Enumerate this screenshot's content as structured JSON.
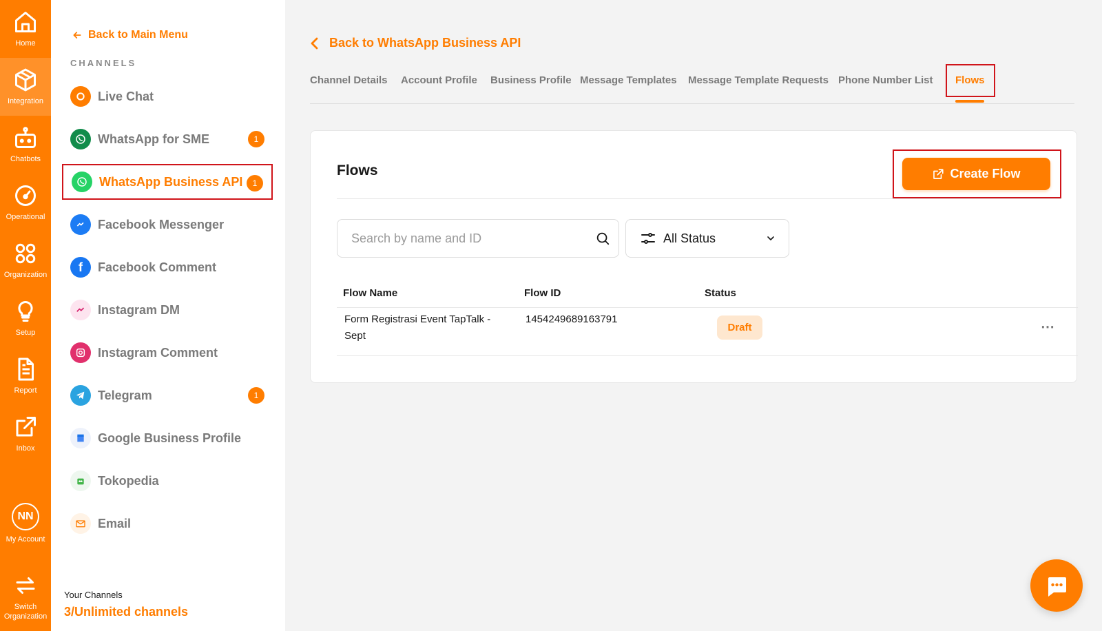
{
  "rail": {
    "items": [
      {
        "label": "Home",
        "icon": "home-icon"
      },
      {
        "label": "Integration",
        "icon": "cube-icon"
      },
      {
        "label": "Chatbots",
        "icon": "robot-icon"
      },
      {
        "label": "Operational",
        "icon": "gauge-icon"
      },
      {
        "label": "Organization",
        "icon": "grid-circles-icon"
      },
      {
        "label": "Setup",
        "icon": "lightbulb-icon"
      },
      {
        "label": "Report",
        "icon": "document-icon"
      },
      {
        "label": "Inbox",
        "icon": "external-link-icon"
      }
    ],
    "account": {
      "initials": "NN",
      "label": "My Account"
    },
    "switch": {
      "label_line1": "Switch",
      "label_line2": "Organization"
    }
  },
  "sidebar": {
    "back_label": "Back to Main Menu",
    "section_title": "CHANNELS",
    "channels": [
      {
        "label": "Live Chat",
        "badge": ""
      },
      {
        "label": "WhatsApp for SME",
        "badge": "1"
      },
      {
        "label": "WhatsApp Business API",
        "badge": "1"
      },
      {
        "label": "Facebook Messenger",
        "badge": ""
      },
      {
        "label": "Facebook Comment",
        "badge": ""
      },
      {
        "label": "Instagram DM",
        "badge": ""
      },
      {
        "label": "Instagram Comment",
        "badge": ""
      },
      {
        "label": "Telegram",
        "badge": "1"
      },
      {
        "label": "Google Business Profile",
        "badge": ""
      },
      {
        "label": "Tokopedia",
        "badge": ""
      },
      {
        "label": "Email",
        "badge": ""
      }
    ],
    "your_channels_label": "Your Channels",
    "your_channels_value": "3/Unlimited channels"
  },
  "main": {
    "back_label": "Back to WhatsApp Business API",
    "tabs": [
      {
        "label": "Channel Details"
      },
      {
        "label": "Account Profile"
      },
      {
        "label": "Business Profile"
      },
      {
        "label": "Message Templates"
      },
      {
        "label": "Message Template Requests"
      },
      {
        "label": "Phone Number List"
      },
      {
        "label": "Flows"
      }
    ],
    "card": {
      "title": "Flows",
      "create_label": "Create Flow",
      "search_placeholder": "Search by name and ID",
      "status_value": "All Status",
      "columns": [
        "Flow Name",
        "Flow ID",
        "Status"
      ],
      "rows": [
        {
          "name_line1": "Form Registrasi Event TapTalk -",
          "name_line2": "Sept",
          "id": "1454249689163791",
          "status": "Draft"
        }
      ]
    }
  },
  "colors": {
    "accent": "#ff7d00",
    "highlight": "#d0141a",
    "draft_bg": "#fee7cf"
  }
}
